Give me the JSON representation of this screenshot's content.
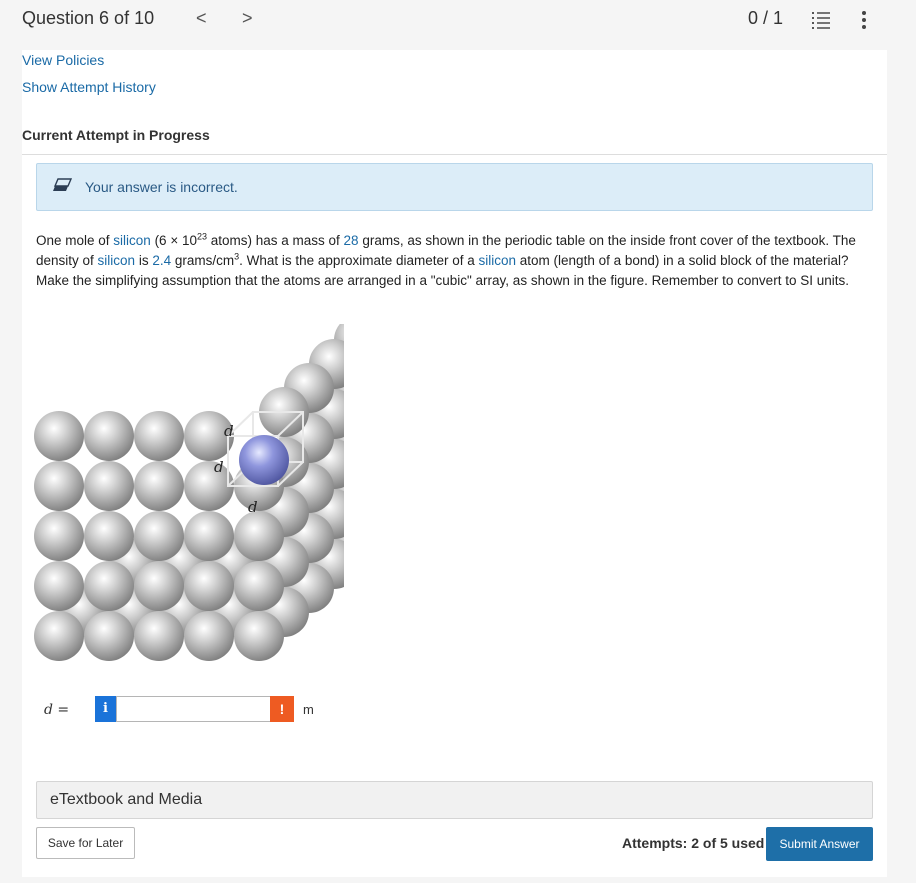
{
  "header": {
    "question_label": "Question 6 of 10",
    "prev_glyph": "<",
    "next_glyph": ">",
    "score": "0 / 1",
    "list_icon": "list-icon",
    "more_icon": "more-vertical-icon"
  },
  "links": {
    "view_policies": "View Policies",
    "attempt_history": "Show Attempt History"
  },
  "attempt_status": "Current Attempt in Progress",
  "feedback": {
    "icon": "eraser-icon",
    "message": "Your answer is incorrect."
  },
  "question": {
    "p1": "One mole of ",
    "silicon": "silicon",
    "p2": " (6 × 10",
    "exp23": "23",
    "p3": " atoms) has a mass of ",
    "mass": "28",
    "p4": " grams, as shown in the periodic table on the inside front cover of the textbook. The density of ",
    "p5": " is ",
    "density": "2.4",
    "p6": " grams/cm",
    "exp3": "3",
    "p7": ". What is the approximate diameter of a ",
    "p8": " atom (length of a bond) in a solid block of the material? Make the simplifying assumption that the atoms are arranged in a \"cubic\" array, as shown in the figure. Remember to convert to SI units."
  },
  "figure": {
    "label_d": "d"
  },
  "answer": {
    "label": "d =",
    "info_glyph": "i",
    "value": "",
    "warn_glyph": "!",
    "unit": "m"
  },
  "etextbook_label": "eTextbook and Media",
  "footer": {
    "save_label": "Save for Later",
    "attempts_text": "Attempts: 2 of 5 used",
    "submit_label": "Submit Answer"
  },
  "colors": {
    "link": "#1a6aa6",
    "alert_bg": "#dcedf8",
    "submit_bg": "#1e6fa8",
    "info_btn": "#1a73d9",
    "warn_btn": "#ee5b22",
    "highlight_atom": "#7f88d6"
  }
}
